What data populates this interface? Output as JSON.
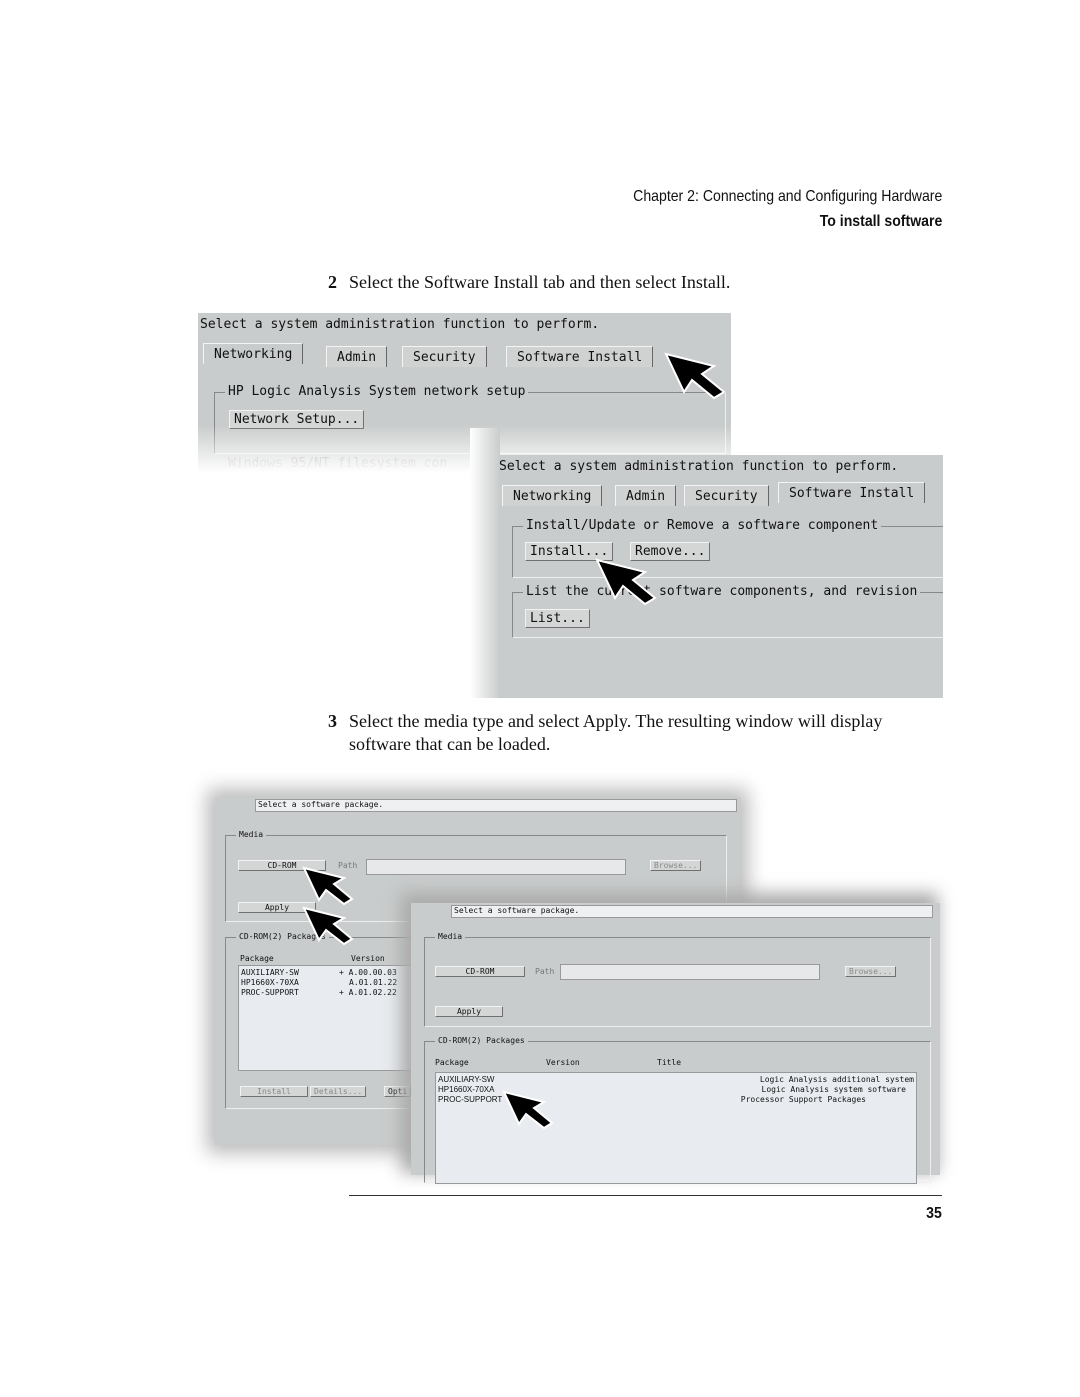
{
  "header": {
    "chapter": "Chapter 2: Connecting and Configuring Hardware",
    "section": "To install software"
  },
  "steps": [
    {
      "number": "2",
      "text": "Select the Software Install tab and then select Install."
    },
    {
      "number": "3",
      "text": "Select the media type and select Apply. The resulting window will display software that can be loaded."
    }
  ],
  "shot1": {
    "prompt": "Select a system administration function to perform.",
    "tabs": [
      "Networking",
      "Admin",
      "Security",
      "Software Install"
    ],
    "group": "HP Logic Analysis System network setup",
    "button": "Network Setup...",
    "faded": "Windows 95/NT filesystem con"
  },
  "shot2": {
    "prompt": "Select a system administration function to perform.",
    "tabs": [
      "Networking",
      "Admin",
      "Security",
      "Software Install"
    ],
    "group1": "Install/Update or Remove a software component",
    "install": "Install...",
    "remove": "Remove...",
    "group2": "List the current software components, and revision",
    "list": "List..."
  },
  "shot3": {
    "prompt": "Select a software package.",
    "media": "Media",
    "media_value": "CD-ROM",
    "path_label": "Path",
    "browse": "Browse...",
    "apply": "Apply",
    "packages_group": "CD-ROM(2) Packages",
    "col_package": "Package",
    "col_version": "Version",
    "rows": [
      {
        "package": "AUXILIARY-SW",
        "version": "+ A.00.00.03"
      },
      {
        "package": "HP1660X-70XA",
        "version": "A.01.01.22"
      },
      {
        "package": "PROC-SUPPORT",
        "version": "+ A.01.02.22"
      }
    ],
    "install": "Install",
    "details": "Details...",
    "options": "Opti"
  },
  "shot4": {
    "prompt": "Select a software package.",
    "media": "Media",
    "media_value": "CD-ROM",
    "path_label": "Path",
    "browse": "Browse...",
    "apply": "Apply",
    "packages_group": "CD-ROM(2) Packages",
    "col_package": "Package",
    "col_version": "Version",
    "col_title": "Title",
    "rows": [
      {
        "package": "AUXILIARY-SW",
        "title": "Logic Analysis additional system"
      },
      {
        "package": "HP1660X-70XA",
        "title": "Logic Analysis system software"
      },
      {
        "package": "PROC-SUPPORT",
        "title": "Processor Support Packages"
      }
    ]
  },
  "footer": {
    "page_number": "35"
  }
}
